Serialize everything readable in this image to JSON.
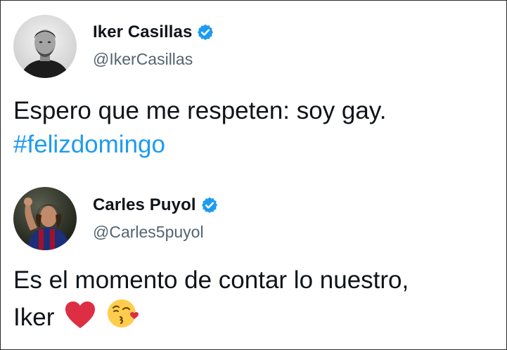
{
  "tweets": [
    {
      "author_name": "Iker Casillas",
      "author_handle": "@IkerCasillas",
      "verified": true,
      "text": "Espero que me respeten: soy gay.",
      "hashtag": "#felizdomingo"
    },
    {
      "author_name": "Carles Puyol",
      "author_handle": "@Carles5puyol",
      "verified": true,
      "text_line1": "Es el momento de contar lo nuestro,",
      "text_line2": "Iker",
      "emojis": [
        "red-heart",
        "face-blowing-a-kiss"
      ]
    }
  ],
  "colors": {
    "text": "#0f1419",
    "handle": "#536471",
    "hashtag": "#1d9bf0",
    "verified_badge": "#1d9bf0",
    "heart": "#dd2e44",
    "kiss_face": "#ffcc4d"
  }
}
